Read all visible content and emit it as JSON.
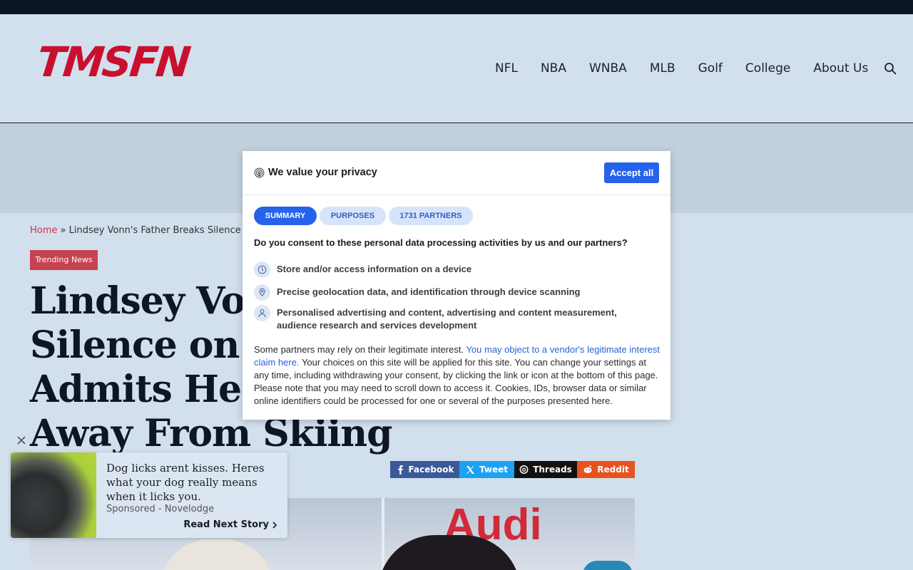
{
  "site": {
    "logo_text": "TMSFN",
    "nav": [
      "NFL",
      "NBA",
      "WNBA",
      "MLB",
      "Golf",
      "College",
      "About Us"
    ],
    "brand_color": "#c8102e"
  },
  "article": {
    "breadcrumb_home": "Home",
    "breadcrumb_sep": "»",
    "breadcrumb_current": "Lindsey Vonn's Father Breaks Silence on",
    "tag": "Trending News",
    "headline_lines": [
      "Lindsey Vonn",
      "Silence on B",
      "Admits He’s",
      "Away From Skiing"
    ]
  },
  "share": {
    "facebook": "Facebook",
    "tweet": "Tweet",
    "threads": "Threads",
    "reddit": "Reddit"
  },
  "hero": {
    "sign_text": "Audi"
  },
  "consent": {
    "title": "We value your privacy",
    "accept_label": "Accept all",
    "tabs": [
      "SUMMARY",
      "PURPOSES",
      "1731 PARTNERS"
    ],
    "question": "Do you consent to these personal data processing activities by us and our partners?",
    "purposes": [
      {
        "icon": "clock-icon",
        "label": "Store and/or access information on a device"
      },
      {
        "icon": "location-pin-icon",
        "label": "Precise geolocation data, and identification through device scanning"
      },
      {
        "icon": "person-icon",
        "label": "Personalised advertising and content, advertising and content measurement, audience research and services development"
      }
    ],
    "body_prefix": "Some partners may rely on their legitimate interest. ",
    "body_link": "You may object to a vendor's legitimate interest claim here.",
    "body_rest": " Your choices on this site will be applied for this site. You can change your settings at any time, including withdrawing your consent, by clicking the link or icon at the bottom of this page. Please note that you may need to scroll down to access it. Cookies, IDs, browser data or similar online identifiers could be processed for one or several of the purposes presented here.",
    "accent_color": "#2563eb"
  },
  "teaser": {
    "title": "Dog licks arent kisses. Heres what your dog really means when it licks you.",
    "sponsor": "Sponsored - Novelodge",
    "read_next": "Read Next Story"
  }
}
